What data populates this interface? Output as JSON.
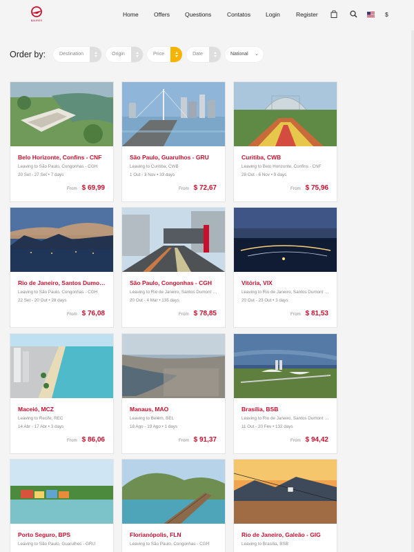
{
  "header": {
    "logo_text": "BAURES",
    "nav": [
      "Home",
      "Offers",
      "Questions",
      "Contatos",
      "Login",
      "Register"
    ],
    "currency": "$",
    "icons": [
      "bag-icon",
      "search-icon",
      "us-flag-icon"
    ]
  },
  "filters": {
    "order_label": "Order by:",
    "items": [
      "Destination",
      "Origin",
      "Price",
      "Date"
    ],
    "active": "Price",
    "select_value": "National"
  },
  "colors": {
    "accent": "#c8102e",
    "sort_active": "#f5b400"
  },
  "cards": [
    {
      "title": "Belo Horizonte, Confins - CNF",
      "leaving": "Leaving to São Paulo, Congonhas - CGH",
      "dates": "20 Set - 27 Set • 7 days",
      "from": "From",
      "price": "$ 69,99"
    },
    {
      "title": "São Paulo, Guarulhos - GRU",
      "leaving": "Leaving to Curitiba, CWB",
      "dates": "1 Out - 3 Nov • 33 days",
      "from": "From",
      "price": "$ 72,67"
    },
    {
      "title": "Curitiba, CWB",
      "leaving": "Leaving to Belo Horizonte, Confins - CNF",
      "dates": "28 Out - 6 Nov • 9 days",
      "from": "From",
      "price": "$ 75,96"
    },
    {
      "title": "Rio de Janeiro, Santos Dumont - SDU",
      "leaving": "Leaving to São Paulo, Congonhas - CGH",
      "dates": "22 Set - 20 Out • 28 days",
      "from": "From",
      "price": "$ 76,08"
    },
    {
      "title": "São Paulo, Congonhas - CGH",
      "leaving": "Leaving to Rio de Janeiro, Santos Dumont - SDU",
      "dates": "20 Out - 4 Mar • 135 days",
      "from": "From",
      "price": "$ 78,85"
    },
    {
      "title": "Vitória, VIX",
      "leaving": "Leaving to Rio de Janeiro, Santos Dumont - SDU",
      "dates": "20 Out - 23 Out • 3 days",
      "from": "From",
      "price": "$ 81,53"
    },
    {
      "title": "Maceió, MCZ",
      "leaving": "Leaving to Recife, REC",
      "dates": "14 Abr - 17 Abr • 3 days",
      "from": "From",
      "price": "$ 86,06"
    },
    {
      "title": "Manaus, MAO",
      "leaving": "Leaving to Belém, BEL",
      "dates": "18 Ago - 19 Ago • 1 days",
      "from": "From",
      "price": "$ 91,37"
    },
    {
      "title": "Brasília, BSB",
      "leaving": "Leaving to Rio de Janeiro, Santos Dumont - SDU",
      "dates": "11 Out - 20 Fev • 132 days",
      "from": "From",
      "price": "$ 94,42"
    },
    {
      "title": "Porto Seguro, BPS",
      "leaving": "Leaving to São Paulo, Guarulhos - GRU",
      "dates": "",
      "from": "",
      "price": ""
    },
    {
      "title": "Florianópolis, FLN",
      "leaving": "Leaving to São Paulo, Congonhas - CGH",
      "dates": "",
      "from": "",
      "price": ""
    },
    {
      "title": "Rio de Janeiro, Galeão - GIG",
      "leaving": "Leaving to Brasília, BSB",
      "dates": "",
      "from": "",
      "price": ""
    }
  ]
}
